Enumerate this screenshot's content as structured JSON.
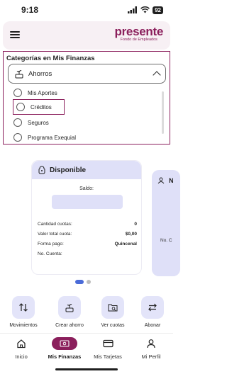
{
  "status": {
    "time": "9:18",
    "battery": "92"
  },
  "brand": {
    "name": "presente",
    "tagline": "Fondo de Empleados"
  },
  "categories": {
    "title": "Categorías en Mis Finanzas",
    "selected": "Ahorros",
    "options": [
      "Mis Aportes",
      "Créditos",
      "Seguros",
      "Programa Exequial"
    ],
    "highlighted": "Créditos"
  },
  "card": {
    "title": "Disponible",
    "saldo_label": "Saldo:",
    "rows": [
      {
        "label": "Cantidad cuotas:",
        "value": "0"
      },
      {
        "label": "Valor total cuota:",
        "value": "$0,00"
      },
      {
        "label": "Forma pago:",
        "value": "Quincenal"
      },
      {
        "label": "No. Cuenta:",
        "value": ""
      }
    ]
  },
  "side_card": {
    "title": "N",
    "row": "No. C"
  },
  "actions": [
    {
      "label": "Movimientos",
      "icon": "arrows-updown-icon"
    },
    {
      "label": "Crear ahorro",
      "icon": "plant-savings-icon"
    },
    {
      "label": "Ver cuotas",
      "icon": "folder-search-icon"
    },
    {
      "label": "Abonar",
      "icon": "transfer-icon"
    }
  ],
  "tabs": [
    {
      "label": "Inicio",
      "icon": "home-icon"
    },
    {
      "label": "Mis Finanzas",
      "icon": "money-icon",
      "active": true
    },
    {
      "label": "Mis Tarjetas",
      "icon": "card-icon"
    },
    {
      "label": "Mi Perfil",
      "icon": "user-icon"
    }
  ],
  "colors": {
    "brand": "#8b1f5c",
    "card_accent": "#dfe0f8",
    "pager_active": "#4a6bd8"
  }
}
